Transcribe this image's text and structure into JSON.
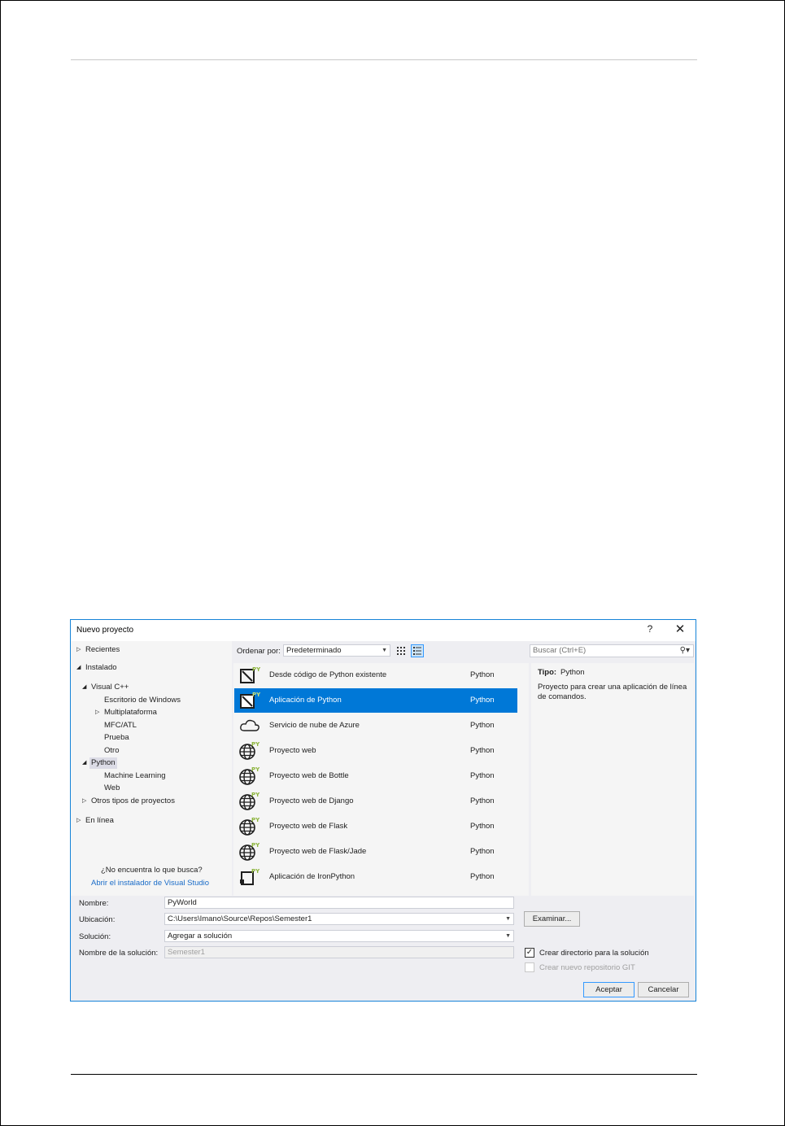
{
  "dialog": {
    "title": "Nuevo proyecto",
    "help_glyph": "?",
    "close_glyph": "✕"
  },
  "tree": {
    "recientes": "Recientes",
    "instalado": "Instalado",
    "visual_cpp": "Visual C++",
    "escritorio_windows": "Escritorio de Windows",
    "multiplataforma": "Multiplataforma",
    "mfc_atl": "MFC/ATL",
    "prueba": "Prueba",
    "otro": "Otro",
    "python": "Python",
    "machine_learning": "Machine Learning",
    "web": "Web",
    "otros_tipos": "Otros tipos de proyectos",
    "en_linea": "En línea",
    "not_found_text": "¿No encuentra lo que busca?",
    "installer_link": "Abrir el instalador de Visual Studio"
  },
  "toolbar": {
    "sort_label": "Ordenar por:",
    "sort_value": "Predeterminado",
    "search_placeholder": "Buscar (Ctrl+E)"
  },
  "templates": [
    {
      "name": "Desde código de Python existente",
      "lang": "Python",
      "icon": "python-existing-code-icon"
    },
    {
      "name": "Aplicación de Python",
      "lang": "Python",
      "icon": "python-app-icon"
    },
    {
      "name": "Servicio de nube de Azure",
      "lang": "Python",
      "icon": "cloud-icon"
    },
    {
      "name": "Proyecto web",
      "lang": "Python",
      "icon": "globe-icon"
    },
    {
      "name": "Proyecto web de Bottle",
      "lang": "Python",
      "icon": "globe-icon"
    },
    {
      "name": "Proyecto web de Django",
      "lang": "Python",
      "icon": "globe-icon"
    },
    {
      "name": "Proyecto web de Flask",
      "lang": "Python",
      "icon": "globe-icon"
    },
    {
      "name": "Proyecto web de Flask/Jade",
      "lang": "Python",
      "icon": "globe-icon"
    },
    {
      "name": "Aplicación de IronPython",
      "lang": "Python",
      "icon": "ironpython-icon"
    }
  ],
  "details": {
    "type_label": "Tipo:",
    "type_value": "Python",
    "description": "Proyecto para crear una aplicación de línea de comandos."
  },
  "form": {
    "name_label": "Nombre:",
    "name_value": "PyWorld",
    "location_label": "Ubicación:",
    "location_value": "C:\\Users\\Imano\\Source\\Repos\\Semester1",
    "solution_label": "Solución:",
    "solution_value": "Agregar a solución",
    "solution_name_label": "Nombre de la solución:",
    "solution_name_value": "Semester1",
    "browse_label": "Examinar...",
    "create_dir_label": "Crear directorio para la solución",
    "create_git_label": "Crear nuevo repositorio GIT",
    "create_dir_check": "✓",
    "accept_label": "Aceptar",
    "cancel_label": "Cancelar"
  },
  "colors": {
    "selection": "#0078d7",
    "accent_border": "#1683d8",
    "python_green": "#8cb43c"
  }
}
